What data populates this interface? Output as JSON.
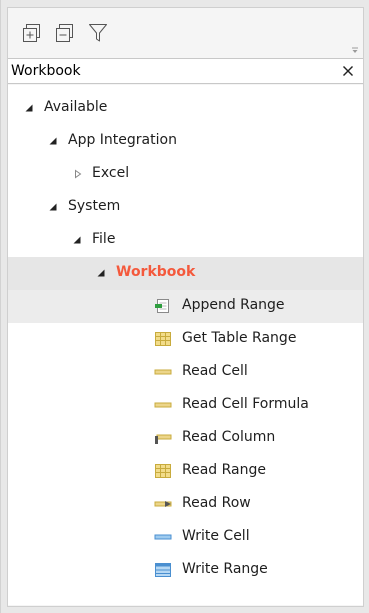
{
  "toolbar": {
    "expand_all_icon": "expand-all-icon",
    "collapse_all_icon": "collapse-all-icon",
    "filter_icon": "filter-icon"
  },
  "search": {
    "value": "Workbook",
    "clear_icon": "close-icon"
  },
  "tree": {
    "available": "Available",
    "app_integration": "App Integration",
    "excel": "Excel",
    "system": "System",
    "file": "File",
    "workbook": "Workbook",
    "activities": [
      {
        "label": "Append Range",
        "icon": "append-range-icon"
      },
      {
        "label": "Get Table Range",
        "icon": "get-table-range-icon"
      },
      {
        "label": "Read Cell",
        "icon": "read-cell-icon"
      },
      {
        "label": "Read Cell Formula",
        "icon": "read-cell-formula-icon"
      },
      {
        "label": "Read Column",
        "icon": "read-column-icon"
      },
      {
        "label": "Read Range",
        "icon": "read-range-icon"
      },
      {
        "label": "Read Row",
        "icon": "read-row-icon"
      },
      {
        "label": "Write Cell",
        "icon": "write-cell-icon"
      },
      {
        "label": "Write Range",
        "icon": "write-range-icon"
      }
    ]
  },
  "colors": {
    "highlight": "#f4593c",
    "selected_bg": "#e6e6e6"
  }
}
